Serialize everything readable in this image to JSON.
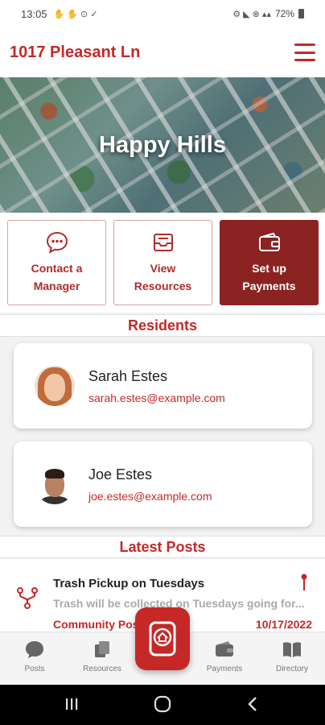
{
  "status_bar": {
    "time": "13:05",
    "notification_icons": "✋ ✋ ⊙ ✓",
    "right_icons": "⚙ ◣ ⊗ ▴▴",
    "battery": "72%"
  },
  "header": {
    "address": "1017 Pleasant Ln",
    "menu_icon": "hamburger-menu-icon"
  },
  "hero": {
    "community_name": "Happy Hills"
  },
  "actions": [
    {
      "label": "Contact a Manager",
      "icon": "chat-bubble-icon"
    },
    {
      "label": "View Resources",
      "icon": "inbox-tray-icon"
    },
    {
      "label": "Set up Payments",
      "icon": "wallet-icon"
    }
  ],
  "residents": {
    "title": "Residents",
    "items": [
      {
        "name": "Sarah Estes",
        "email": "sarah.estes@example.com"
      },
      {
        "name": "Joe Estes",
        "email": "joe.estes@example.com"
      }
    ]
  },
  "latest_posts": {
    "title": "Latest Posts",
    "items": [
      {
        "title": "Trash Pickup on Tuesdays",
        "excerpt": "Trash will be collected on Tuesdays going for...",
        "category": "Community Posts",
        "date": "10/17/2022"
      }
    ]
  },
  "bottom_nav": {
    "items": [
      {
        "label": "Posts",
        "icon": "posts-icon"
      },
      {
        "label": "Resources",
        "icon": "resources-icon"
      },
      {
        "label": "Payments",
        "icon": "wallet-icon"
      },
      {
        "label": "Directory",
        "icon": "book-icon"
      }
    ],
    "home_icon": "home-icon"
  },
  "colors": {
    "accent": "#c62828",
    "primary_dark": "#8b2323",
    "background": "#f2f2f2"
  }
}
